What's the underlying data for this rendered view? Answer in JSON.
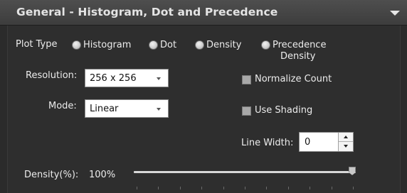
{
  "header": {
    "title": "General - Histogram, Dot and Precedence",
    "collapse_icon": "chevron-down-icon"
  },
  "plot_type": {
    "label": "Plot Type",
    "options": [
      {
        "label": "Histogram"
      },
      {
        "label": "Dot"
      },
      {
        "label": "Density"
      },
      {
        "label_line1": "Precedence",
        "label_line2": "Density"
      }
    ]
  },
  "resolution": {
    "label": "Resolution:",
    "value": "256 x 256"
  },
  "mode": {
    "label": "Mode:",
    "value": "Linear"
  },
  "normalize_count": {
    "label": "Normalize Count",
    "checked": false
  },
  "use_shading": {
    "label": "Use Shading",
    "checked": false
  },
  "line_width": {
    "label": "Line Width:",
    "value": "0"
  },
  "density": {
    "label": "Density(%):",
    "value": "100%",
    "slider_fraction": 1.0
  },
  "colors": {
    "header_bg": "#444444",
    "panel_bg": "#2e2e2e",
    "text": "#ececec"
  }
}
